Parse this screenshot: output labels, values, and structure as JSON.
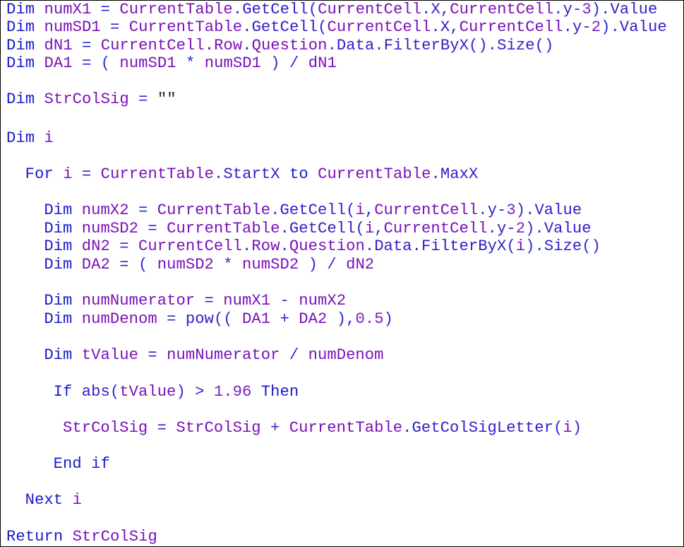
{
  "code": {
    "language": "VBScript-like",
    "lines": [
      {
        "indent": 0,
        "tokens": [
          {
            "t": "Dim",
            "c": "kw"
          },
          {
            "t": " ",
            "c": "op"
          },
          {
            "t": "numX1",
            "c": "id"
          },
          {
            "t": " = ",
            "c": "op"
          },
          {
            "t": "CurrentTable",
            "c": "id"
          },
          {
            "t": ".",
            "c": "op"
          },
          {
            "t": "GetCell",
            "c": "mem"
          },
          {
            "t": "(",
            "c": "op"
          },
          {
            "t": "CurrentCell",
            "c": "id"
          },
          {
            "t": ".",
            "c": "op"
          },
          {
            "t": "X",
            "c": "mem"
          },
          {
            "t": ",",
            "c": "op"
          },
          {
            "t": "CurrentCell",
            "c": "id"
          },
          {
            "t": ".",
            "c": "op"
          },
          {
            "t": "y",
            "c": "mem"
          },
          {
            "t": "-",
            "c": "op"
          },
          {
            "t": "3",
            "c": "num"
          },
          {
            "t": ").",
            "c": "op"
          },
          {
            "t": "Value",
            "c": "mem"
          }
        ]
      },
      {
        "indent": 0,
        "tokens": [
          {
            "t": "Dim",
            "c": "kw"
          },
          {
            "t": " ",
            "c": "op"
          },
          {
            "t": "numSD1",
            "c": "id"
          },
          {
            "t": " = ",
            "c": "op"
          },
          {
            "t": "CurrentTable",
            "c": "id"
          },
          {
            "t": ".",
            "c": "op"
          },
          {
            "t": "GetCell",
            "c": "mem"
          },
          {
            "t": "(",
            "c": "op"
          },
          {
            "t": "CurrentCell",
            "c": "id"
          },
          {
            "t": ".",
            "c": "op"
          },
          {
            "t": "X",
            "c": "mem"
          },
          {
            "t": ",",
            "c": "op"
          },
          {
            "t": "CurrentCell",
            "c": "id"
          },
          {
            "t": ".",
            "c": "op"
          },
          {
            "t": "y",
            "c": "mem"
          },
          {
            "t": "-",
            "c": "op"
          },
          {
            "t": "2",
            "c": "num"
          },
          {
            "t": ").",
            "c": "op"
          },
          {
            "t": "Value",
            "c": "mem"
          }
        ]
      },
      {
        "indent": 0,
        "tokens": [
          {
            "t": "Dim",
            "c": "kw"
          },
          {
            "t": " ",
            "c": "op"
          },
          {
            "t": "dN1",
            "c": "id"
          },
          {
            "t": " = ",
            "c": "op"
          },
          {
            "t": "CurrentCell",
            "c": "id"
          },
          {
            "t": ".",
            "c": "op"
          },
          {
            "t": "Row",
            "c": "id"
          },
          {
            "t": ".",
            "c": "op"
          },
          {
            "t": "Question",
            "c": "id"
          },
          {
            "t": ".",
            "c": "op"
          },
          {
            "t": "Data",
            "c": "mem"
          },
          {
            "t": ".",
            "c": "op"
          },
          {
            "t": "FilterByX",
            "c": "mem"
          },
          {
            "t": "().",
            "c": "op"
          },
          {
            "t": "Size",
            "c": "mem"
          },
          {
            "t": "()",
            "c": "op"
          }
        ]
      },
      {
        "indent": 0,
        "tokens": [
          {
            "t": "Dim",
            "c": "kw"
          },
          {
            "t": " ",
            "c": "op"
          },
          {
            "t": "DA1",
            "c": "id"
          },
          {
            "t": " = ( ",
            "c": "op"
          },
          {
            "t": "numSD1",
            "c": "id"
          },
          {
            "t": " * ",
            "c": "op"
          },
          {
            "t": "numSD1",
            "c": "id"
          },
          {
            "t": " ) / ",
            "c": "op"
          },
          {
            "t": "dN1",
            "c": "id"
          }
        ]
      },
      {
        "indent": 0,
        "tokens": [
          {
            "t": "Dim",
            "c": "kw"
          },
          {
            "t": " ",
            "c": "op"
          },
          {
            "t": "StrColSig",
            "c": "id"
          },
          {
            "t": " = ",
            "c": "op"
          },
          {
            "t": "\"\"",
            "c": "str"
          }
        ]
      },
      {
        "indent": 0,
        "tokens": [
          {
            "t": "Dim",
            "c": "kw"
          },
          {
            "t": " ",
            "c": "op"
          },
          {
            "t": "i",
            "c": "id"
          }
        ]
      },
      {
        "indent": 2,
        "tokens": [
          {
            "t": "For",
            "c": "kw"
          },
          {
            "t": " ",
            "c": "op"
          },
          {
            "t": "i",
            "c": "id"
          },
          {
            "t": " = ",
            "c": "op"
          },
          {
            "t": "CurrentTable",
            "c": "id"
          },
          {
            "t": ".",
            "c": "op"
          },
          {
            "t": "StartX",
            "c": "mem"
          },
          {
            "t": " ",
            "c": "op"
          },
          {
            "t": "to",
            "c": "kw"
          },
          {
            "t": " ",
            "c": "op"
          },
          {
            "t": "CurrentTable",
            "c": "id"
          },
          {
            "t": ".",
            "c": "op"
          },
          {
            "t": "MaxX",
            "c": "mem"
          }
        ]
      },
      {
        "indent": 4,
        "tokens": [
          {
            "t": "Dim",
            "c": "kw"
          },
          {
            "t": " ",
            "c": "op"
          },
          {
            "t": "numX2",
            "c": "id"
          },
          {
            "t": " = ",
            "c": "op"
          },
          {
            "t": "CurrentTable",
            "c": "id"
          },
          {
            "t": ".",
            "c": "op"
          },
          {
            "t": "GetCell",
            "c": "mem"
          },
          {
            "t": "(",
            "c": "op"
          },
          {
            "t": "i",
            "c": "id"
          },
          {
            "t": ",",
            "c": "op"
          },
          {
            "t": "CurrentCell",
            "c": "id"
          },
          {
            "t": ".",
            "c": "op"
          },
          {
            "t": "y",
            "c": "mem"
          },
          {
            "t": "-",
            "c": "op"
          },
          {
            "t": "3",
            "c": "num"
          },
          {
            "t": ").",
            "c": "op"
          },
          {
            "t": "Value",
            "c": "mem"
          }
        ]
      },
      {
        "indent": 4,
        "tokens": [
          {
            "t": "Dim",
            "c": "kw"
          },
          {
            "t": " ",
            "c": "op"
          },
          {
            "t": "numSD2",
            "c": "id"
          },
          {
            "t": " = ",
            "c": "op"
          },
          {
            "t": "CurrentTable",
            "c": "id"
          },
          {
            "t": ".",
            "c": "op"
          },
          {
            "t": "GetCell",
            "c": "mem"
          },
          {
            "t": "(",
            "c": "op"
          },
          {
            "t": "i",
            "c": "id"
          },
          {
            "t": ",",
            "c": "op"
          },
          {
            "t": "CurrentCell",
            "c": "id"
          },
          {
            "t": ".",
            "c": "op"
          },
          {
            "t": "y",
            "c": "mem"
          },
          {
            "t": "-",
            "c": "op"
          },
          {
            "t": "2",
            "c": "num"
          },
          {
            "t": ").",
            "c": "op"
          },
          {
            "t": "Value",
            "c": "mem"
          }
        ]
      },
      {
        "indent": 4,
        "tokens": [
          {
            "t": "Dim",
            "c": "kw"
          },
          {
            "t": " ",
            "c": "op"
          },
          {
            "t": "dN2",
            "c": "id"
          },
          {
            "t": " = ",
            "c": "op"
          },
          {
            "t": "CurrentCell",
            "c": "id"
          },
          {
            "t": ".",
            "c": "op"
          },
          {
            "t": "Row",
            "c": "id"
          },
          {
            "t": ".",
            "c": "op"
          },
          {
            "t": "Question",
            "c": "id"
          },
          {
            "t": ".",
            "c": "op"
          },
          {
            "t": "Data",
            "c": "mem"
          },
          {
            "t": ".",
            "c": "op"
          },
          {
            "t": "FilterByX",
            "c": "mem"
          },
          {
            "t": "(",
            "c": "op"
          },
          {
            "t": "i",
            "c": "id"
          },
          {
            "t": ").",
            "c": "op"
          },
          {
            "t": "Size",
            "c": "mem"
          },
          {
            "t": "()",
            "c": "op"
          }
        ]
      },
      {
        "indent": 4,
        "tokens": [
          {
            "t": "Dim",
            "c": "kw"
          },
          {
            "t": " ",
            "c": "op"
          },
          {
            "t": "DA2",
            "c": "id"
          },
          {
            "t": " = ( ",
            "c": "op"
          },
          {
            "t": "numSD2",
            "c": "id"
          },
          {
            "t": " * ",
            "c": "op"
          },
          {
            "t": "numSD2",
            "c": "id"
          },
          {
            "t": " ) / ",
            "c": "op"
          },
          {
            "t": "dN2",
            "c": "id"
          }
        ]
      },
      {
        "indent": 4,
        "tokens": [
          {
            "t": "Dim",
            "c": "kw"
          },
          {
            "t": " ",
            "c": "op"
          },
          {
            "t": "numNumerator",
            "c": "id"
          },
          {
            "t": " = ",
            "c": "op"
          },
          {
            "t": "numX1",
            "c": "id"
          },
          {
            "t": " - ",
            "c": "op"
          },
          {
            "t": "numX2",
            "c": "id"
          }
        ]
      },
      {
        "indent": 4,
        "tokens": [
          {
            "t": "Dim",
            "c": "kw"
          },
          {
            "t": " ",
            "c": "op"
          },
          {
            "t": "numDenom",
            "c": "id"
          },
          {
            "t": " = ",
            "c": "op"
          },
          {
            "t": "pow",
            "c": "mem"
          },
          {
            "t": "(( ",
            "c": "op"
          },
          {
            "t": "DA1",
            "c": "id"
          },
          {
            "t": " + ",
            "c": "op"
          },
          {
            "t": "DA2",
            "c": "id"
          },
          {
            "t": " ),",
            "c": "op"
          },
          {
            "t": "0.5",
            "c": "num"
          },
          {
            "t": ")",
            "c": "op"
          }
        ]
      },
      {
        "indent": 4,
        "tokens": [
          {
            "t": "Dim",
            "c": "kw"
          },
          {
            "t": " ",
            "c": "op"
          },
          {
            "t": "tValue",
            "c": "id"
          },
          {
            "t": " = ",
            "c": "op"
          },
          {
            "t": "numNumerator",
            "c": "id"
          },
          {
            "t": " / ",
            "c": "op"
          },
          {
            "t": "numDenom",
            "c": "id"
          }
        ]
      },
      {
        "indent": 5,
        "tokens": [
          {
            "t": "If",
            "c": "kw"
          },
          {
            "t": " ",
            "c": "op"
          },
          {
            "t": "abs",
            "c": "mem"
          },
          {
            "t": "(",
            "c": "op"
          },
          {
            "t": "tValue",
            "c": "id"
          },
          {
            "t": ") > ",
            "c": "op"
          },
          {
            "t": "1.96",
            "c": "num"
          },
          {
            "t": " ",
            "c": "op"
          },
          {
            "t": "Then",
            "c": "kw"
          }
        ]
      },
      {
        "indent": 6,
        "tokens": [
          {
            "t": "StrColSig",
            "c": "id"
          },
          {
            "t": " = ",
            "c": "op"
          },
          {
            "t": "StrColSig",
            "c": "id"
          },
          {
            "t": " + ",
            "c": "op"
          },
          {
            "t": "CurrentTable",
            "c": "id"
          },
          {
            "t": ".",
            "c": "op"
          },
          {
            "t": "GetColSigLetter",
            "c": "mem"
          },
          {
            "t": "(",
            "c": "op"
          },
          {
            "t": "i",
            "c": "id"
          },
          {
            "t": ")",
            "c": "op"
          }
        ]
      },
      {
        "indent": 5,
        "tokens": [
          {
            "t": "End",
            "c": "kw"
          },
          {
            "t": " ",
            "c": "op"
          },
          {
            "t": "if",
            "c": "kw"
          }
        ]
      },
      {
        "indent": 2,
        "tokens": [
          {
            "t": "Next",
            "c": "kw"
          },
          {
            "t": " ",
            "c": "op"
          },
          {
            "t": "i",
            "c": "id"
          }
        ]
      },
      {
        "indent": 0,
        "tokens": [
          {
            "t": "Return",
            "c": "kw"
          },
          {
            "t": " ",
            "c": "op"
          },
          {
            "t": "StrColSig",
            "c": "id"
          }
        ]
      }
    ]
  }
}
